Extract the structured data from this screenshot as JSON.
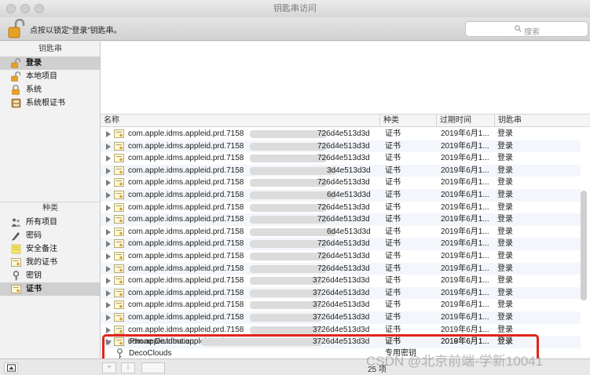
{
  "window": {
    "title": "钥匙串访问"
  },
  "toolbar": {
    "lock_text": "点按以锁定“登录”钥匙串。",
    "search_placeholder": "搜索"
  },
  "sidebar": {
    "keychains_header": "钥匙串",
    "keychains": [
      {
        "label": "登录",
        "icon": "lock-open-icon",
        "selected": true
      },
      {
        "label": "本地项目",
        "icon": "lock-open-icon",
        "selected": false
      },
      {
        "label": "系统",
        "icon": "lock-icon",
        "selected": false
      },
      {
        "label": "系统根证书",
        "icon": "cabinet-icon",
        "selected": false
      }
    ],
    "categories_header": "种类",
    "categories": [
      {
        "label": "所有项目",
        "icon": "people-icon",
        "selected": false
      },
      {
        "label": "密码",
        "icon": "pen-icon",
        "selected": false
      },
      {
        "label": "安全备注",
        "icon": "note-icon",
        "selected": false
      },
      {
        "label": "我的证书",
        "icon": "certificate-icon",
        "selected": false
      },
      {
        "label": "密钥",
        "icon": "key-icon",
        "selected": false
      },
      {
        "label": "证书",
        "icon": "certificate-icon",
        "selected": true
      }
    ]
  },
  "table": {
    "columns": [
      "名称",
      "种类",
      "过期时间",
      "钥匙串"
    ],
    "rows": [
      {
        "name_start": "com.apple.idms.appleid.prd.7158",
        "name_end": "726d4e513d3d",
        "kind": "证书",
        "expires": "2019年6月1...",
        "keychain": "登录"
      },
      {
        "name_start": "com.apple.idms.appleid.prd.7158",
        "name_end": "726d4e513d3d",
        "kind": "证书",
        "expires": "2019年6月1...",
        "keychain": "登录"
      },
      {
        "name_start": "com.apple.idms.appleid.prd.7158",
        "name_end": "726d4e513d3d",
        "kind": "证书",
        "expires": "2019年6月1...",
        "keychain": "登录"
      },
      {
        "name_start": "com.apple.idms.appleid.prd.7158",
        "name_end": "3d4e513d3d",
        "kind": "证书",
        "expires": "2019年6月1...",
        "keychain": "登录"
      },
      {
        "name_start": "com.apple.idms.appleid.prd.7158",
        "name_end": "726d4e513d3d",
        "kind": "证书",
        "expires": "2019年6月1...",
        "keychain": "登录"
      },
      {
        "name_start": "com.apple.idms.appleid.prd.7158",
        "name_end": "6d4e513d3d",
        "kind": "证书",
        "expires": "2019年6月1...",
        "keychain": "登录"
      },
      {
        "name_start": "com.apple.idms.appleid.prd.7158",
        "name_end": "726d4e513d3d",
        "kind": "证书",
        "expires": "2019年6月1...",
        "keychain": "登录"
      },
      {
        "name_start": "com.apple.idms.appleid.prd.7158",
        "name_end": "726d4e513d3d",
        "kind": "证书",
        "expires": "2019年6月1...",
        "keychain": "登录"
      },
      {
        "name_start": "com.apple.idms.appleid.prd.7158",
        "name_end": "6d4e513d3d",
        "kind": "证书",
        "expires": "2019年6月1...",
        "keychain": "登录"
      },
      {
        "name_start": "com.apple.idms.appleid.prd.7158",
        "name_end": "726d4e513d3d",
        "kind": "证书",
        "expires": "2019年6月1...",
        "keychain": "登录"
      },
      {
        "name_start": "com.apple.idms.appleid.prd.7158",
        "name_end": "726d4e513d3d",
        "kind": "证书",
        "expires": "2019年6月1...",
        "keychain": "登录"
      },
      {
        "name_start": "com.apple.idms.appleid.prd.7158",
        "name_end": "726d4e513d3d",
        "kind": "证书",
        "expires": "2019年6月1...",
        "keychain": "登录"
      },
      {
        "name_start": "com.apple.idms.appleid.prd.7158",
        "name_end": "3726d4e513d3d",
        "kind": "证书",
        "expires": "2019年6月1...",
        "keychain": "登录"
      },
      {
        "name_start": "com.apple.idms.appleid.prd.7158",
        "name_end": "3726d4e513d3d",
        "kind": "证书",
        "expires": "2019年6月1...",
        "keychain": "登录"
      },
      {
        "name_start": "com.apple.idms.appleid.prd.7158",
        "name_end": "3726d4e513d3d",
        "kind": "证书",
        "expires": "2019年6月1...",
        "keychain": "登录"
      },
      {
        "name_start": "com.apple.idms.appleid.prd.7158",
        "name_end": "3726d4e513d3d",
        "kind": "证书",
        "expires": "2019年6月1...",
        "keychain": "登录"
      },
      {
        "name_start": "com.apple.idms.appleid.prd.7158",
        "name_end": "3726d4e513d3d",
        "kind": "证书",
        "expires": "2019年6月1...",
        "keychain": "登录"
      },
      {
        "name_start": "com.apple.idms.appleid.prd.7158",
        "name_end": "3726d4e513d3d",
        "kind": "证书",
        "expires": "2019年6月1...",
        "keychain": "登录"
      }
    ],
    "selected_row": {
      "name": "iPhone Distribution:",
      "kind": "证书",
      "expires": "2018年6月1...",
      "keychain": "登录"
    },
    "child_row": {
      "name": "DecoClouds",
      "kind": "专用密钥"
    }
  },
  "bottom": {
    "count": "25 项",
    "add_label": "+",
    "info_label": "i"
  },
  "watermark": "CSDN @北京前端-学新10041",
  "colors": {
    "highlight_box": "#e1251b",
    "selection": "#d0d0d0"
  }
}
